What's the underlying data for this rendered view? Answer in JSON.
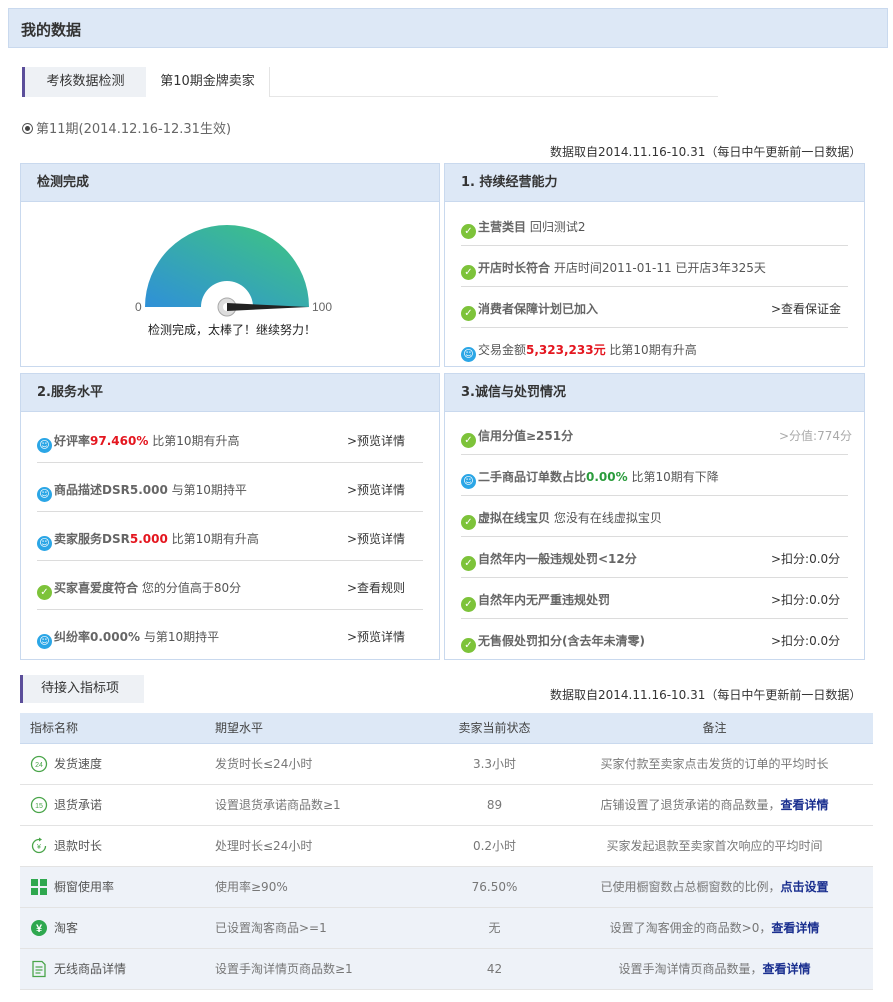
{
  "page_title": "我的数据",
  "tabs": [
    "考核数据检测",
    "第10期金牌卖家"
  ],
  "period": "第11期(2014.12.16-12.31生效)",
  "data_note": "数据取自2014.11.16-10.31（每日中午更新前一日数据）",
  "panels": {
    "check": {
      "title": "检测完成",
      "gauge": {
        "min_label": "0",
        "max_label": "100",
        "value": 100,
        "message": "检测完成，太棒了！继续努力！"
      }
    },
    "p1": {
      "title": "1. 持续经营能力",
      "rows": [
        {
          "label": "主营类目",
          "desc": "回归测试2",
          "link": ""
        },
        {
          "label": "开店时长符合",
          "desc": "开店时间2011-01-11 已开店3年325天",
          "link": ""
        },
        {
          "label": "消费者保障计划已加入",
          "desc": "",
          "link": ">查看保证金"
        },
        {
          "label": "交易金额",
          "value": "5,323,233元",
          "desc": "比第10期有升高"
        }
      ]
    },
    "p2": {
      "title": "2.服务水平",
      "rows": [
        {
          "label": "好评率",
          "value": "97.460%",
          "desc": "比第10期有升高",
          "link": ">预览详情"
        },
        {
          "label": "商品描述DSR5.000",
          "desc": "与第10期持平",
          "link": ">预览详情"
        },
        {
          "label": "卖家服务DSR",
          "value": "5.000",
          "desc": "比第10期有升高",
          "link": ">预览详情"
        },
        {
          "label": "买家喜爱度符合",
          "desc": "您的分值高于80分",
          "link": ">查看规则"
        },
        {
          "label": "纠纷率0.000%",
          "desc": "与第10期持平",
          "link": ">预览详情"
        }
      ]
    },
    "p3": {
      "title": "3.诚信与处罚情况",
      "rows": [
        {
          "label": "信用分值≥251分",
          "desc": "",
          "link": ">分值:774分"
        },
        {
          "label": "二手商品订单数占比",
          "value": "0.00%",
          "desc": "比第10期有下降",
          "link": ""
        },
        {
          "label": "虚拟在线宝贝",
          "desc": "您没有在线虚拟宝贝",
          "link": ""
        },
        {
          "label": "自然年内一般违规处罚<12分",
          "desc": "",
          "link": ">扣分:0.0分"
        },
        {
          "label": "自然年内无严重违规处罚",
          "desc": "",
          "link": ">扣分:0.0分"
        },
        {
          "label": "无售假处罚扣分(含去年未清零)",
          "desc": "",
          "link": ">扣分:0.0分"
        }
      ]
    }
  },
  "pending": {
    "title": "待接入指标项",
    "headers": [
      "指标名称",
      "期望水平",
      "卖家当前状态",
      "备注"
    ],
    "rows": [
      {
        "icon": "24h-clock-icon",
        "name": "发货速度",
        "expect": "发货时长≤24小时",
        "status": "3.3小时",
        "note": "买家付款至卖家点击发货的订单的平均时长",
        "link": ""
      },
      {
        "icon": "15-day-icon",
        "name": "退货承诺",
        "expect": "设置退货承诺商品数≥1",
        "status": "89",
        "note": "店铺设置了退货承诺的商品数量，",
        "link": "查看详情"
      },
      {
        "icon": "refund-clock-icon",
        "name": "退款时长",
        "expect": "处理时长≤24小时",
        "status": "0.2小时",
        "note": "买家发起退款至卖家首次响应的平均时间",
        "link": ""
      },
      {
        "icon": "window-grid-icon",
        "name": "橱窗使用率",
        "expect": "使用率≥90%",
        "status": "76.50%",
        "note": "已使用橱窗数占总橱窗数的比例，",
        "link": "点击设置"
      },
      {
        "icon": "yen-icon",
        "name": "淘客",
        "expect": "已设置淘客商品>=1",
        "status": "无",
        "note": "设置了淘客佣金的商品数>0，",
        "link": "查看详情"
      },
      {
        "icon": "document-icon",
        "name": "无线商品详情",
        "expect": "设置手淘详情页商品数≥1",
        "status": "42",
        "note": "设置手淘详情页商品数量，",
        "link": "查看详情"
      }
    ]
  },
  "colors": {
    "accent": "#5b4e9a",
    "header_bg": "#dde8f6",
    "red": "#e4161f",
    "green": "#2a9c3c",
    "check": "#7dc33a",
    "smile": "#2ba6e6"
  }
}
